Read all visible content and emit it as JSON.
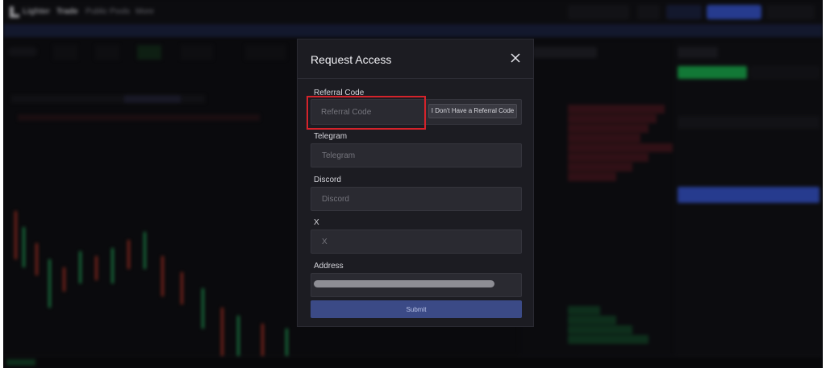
{
  "modal": {
    "title": "Request Access",
    "fields": {
      "referral": {
        "label": "Referral Code",
        "placeholder": "Referral Code",
        "value": ""
      },
      "telegram": {
        "label": "Telegram",
        "placeholder": "Telegram",
        "value": ""
      },
      "discord": {
        "label": "Discord",
        "placeholder": "Discord",
        "value": ""
      },
      "x": {
        "label": "X",
        "placeholder": "X",
        "value": ""
      },
      "address": {
        "label": "Address"
      }
    },
    "no_referral_label": "I Don't Have a Referral Code",
    "submit_label": "Submit",
    "highlight_color": "#d4232b"
  },
  "background": {
    "app_name": "Lighter",
    "nav": [
      "Trade",
      "Public Pools",
      "More"
    ],
    "accent_blue": "#3b5bdb",
    "buy_green": "#1db954",
    "sell_red": "#c0392b"
  }
}
